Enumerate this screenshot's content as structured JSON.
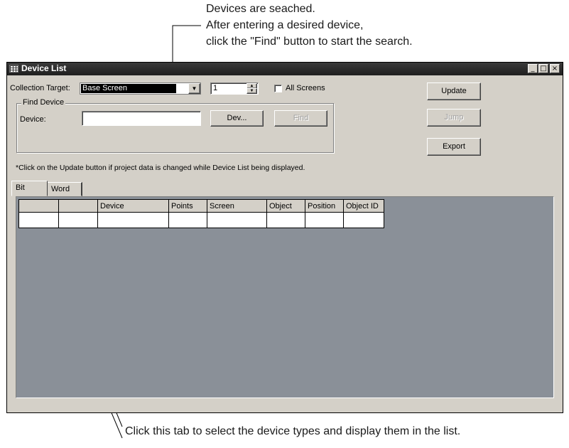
{
  "annotations": {
    "top_lines": [
      "Devices are seached.",
      "After entering a desired device,",
      "click the \"Find\" button to start the search."
    ],
    "bottom_text": "Click this tab to select the device types and display them in the list."
  },
  "window": {
    "title": "Device List",
    "controls": {
      "minimize": "_",
      "maximize": "□",
      "close": "×"
    }
  },
  "collection": {
    "label": "Collection Target:",
    "selected": "Base Screen",
    "screen_number": "1",
    "all_screens_label": "All Screens",
    "all_screens_checked": false
  },
  "find_device": {
    "group_label": "Find Device",
    "device_label": "Device:",
    "device_value": "",
    "dev_button": "Dev...",
    "find_button": "Find"
  },
  "buttons": {
    "update": "Update",
    "jump": "Jump",
    "export": "Export"
  },
  "note": "*Click on the Update button if project data is changed while Device List being displayed.",
  "tabs": [
    {
      "label": "Bit",
      "active": true
    },
    {
      "label": "Word",
      "active": false
    }
  ],
  "table": {
    "columns": [
      "",
      "",
      "Device",
      "Points",
      "Screen",
      "Object",
      "Position",
      "Object ID"
    ],
    "rows": [
      [
        "",
        "",
        "",
        "",
        "",
        "",
        "",
        ""
      ]
    ]
  }
}
